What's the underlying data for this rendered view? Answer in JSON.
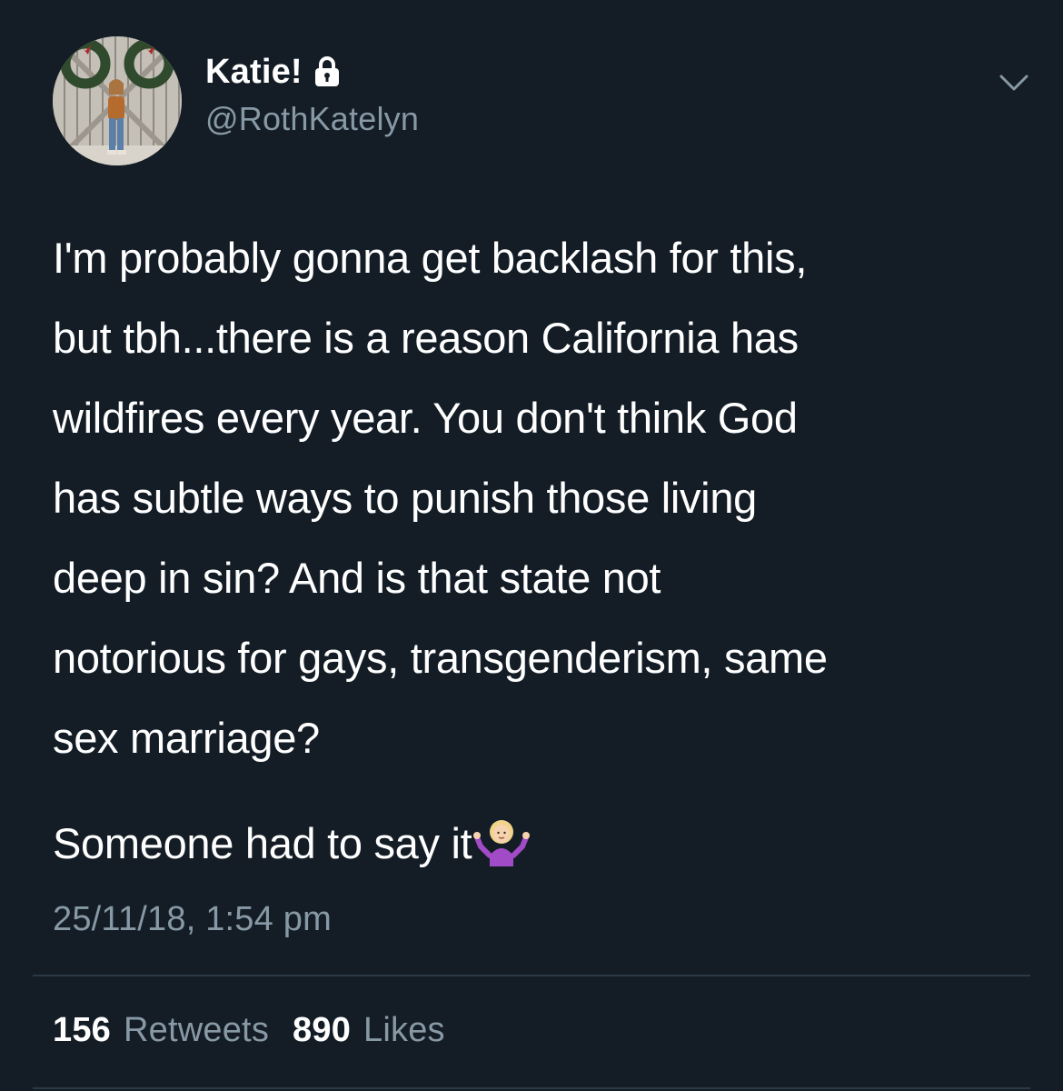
{
  "colors": {
    "background": "#141d26",
    "primary_text": "#ffffff",
    "secondary_text": "#8899a6",
    "divider": "#2b3946"
  },
  "author": {
    "display_name": "Katie!",
    "handle": "@RothKatelyn",
    "protected_icon": "lock-icon",
    "avatar_icon": "profile-photo"
  },
  "menu_icon": "chevron-down-icon",
  "tweet": {
    "lines": [
      "I'm probably gonna get backlash for this,",
      "but tbh...there is a reason California has",
      "wildfires every year. You don't think God",
      "has subtle ways to punish those living",
      "deep in sin? And is that state not",
      "notorious for gays, transgenderism, same",
      "sex marriage?"
    ],
    "second_paragraph": "Someone had to say it",
    "emoji_icon": "person-shrugging-icon",
    "timestamp": "25/11/18, 1:54 pm"
  },
  "stats": {
    "retweets_count": "156",
    "retweets_label": "Retweets",
    "likes_count": "890",
    "likes_label": "Likes"
  }
}
